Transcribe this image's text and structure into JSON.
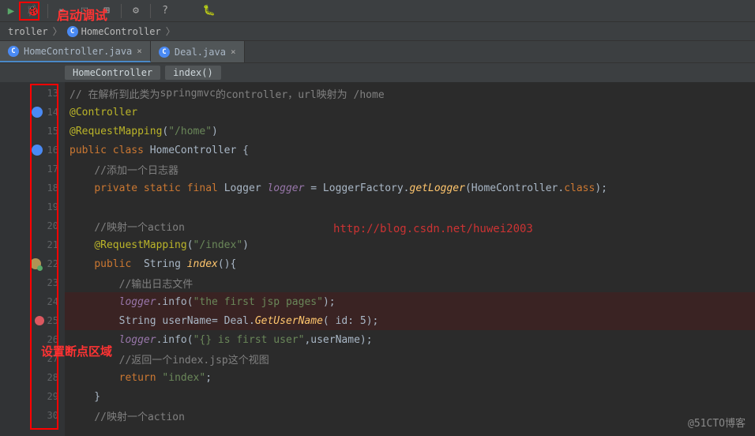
{
  "annotations": {
    "start_debug": "启动调试",
    "breakpoint_region": "设置断点区域"
  },
  "toolbar": {
    "run": "▶",
    "debug": "🐞"
  },
  "breadcrumb": {
    "item1": "troller",
    "item2": "HomeController"
  },
  "tabs": [
    {
      "label": "HomeController.java",
      "active": true
    },
    {
      "label": "Deal.java",
      "active": false
    }
  ],
  "code_breadcrumb": {
    "class": "HomeController",
    "method": "index()"
  },
  "watermark_url": "http://blog.csdn.net/huwei2003",
  "watermark_blog": "@51CTO博客",
  "lines": [
    {
      "n": 13,
      "tokens": [
        [
          "c-comment",
          "// 在解析到此类为"
        ],
        [
          "c-comment",
          "springmvc"
        ],
        [
          "c-comment",
          "的controller，url映射为 /home"
        ]
      ]
    },
    {
      "n": 14,
      "icon": "class",
      "tokens": [
        [
          "c-anno",
          "@Controller"
        ]
      ]
    },
    {
      "n": 15,
      "tokens": [
        [
          "c-anno",
          "@RequestMapping"
        ],
        [
          "c-white",
          "("
        ],
        [
          "c-string",
          "\"/home\""
        ],
        [
          "c-white",
          ")"
        ]
      ]
    },
    {
      "n": 16,
      "icon": "class",
      "tokens": [
        [
          "c-keyword",
          "public class "
        ],
        [
          "c-class",
          "HomeController {"
        ]
      ]
    },
    {
      "n": 17,
      "tokens": [
        [
          "c-white",
          "    "
        ],
        [
          "c-comment",
          "//添加一个日志器"
        ]
      ]
    },
    {
      "n": 18,
      "tokens": [
        [
          "c-white",
          "    "
        ],
        [
          "c-keyword",
          "private static final "
        ],
        [
          "c-class",
          "Logger "
        ],
        [
          "c-field",
          "logger"
        ],
        [
          "c-white",
          " = LoggerFactory."
        ],
        [
          "c-method",
          "getLogger"
        ],
        [
          "c-white",
          "(HomeController."
        ],
        [
          "c-keyword",
          "class"
        ],
        [
          "c-white",
          ");"
        ]
      ]
    },
    {
      "n": 19,
      "tokens": []
    },
    {
      "n": 20,
      "tokens": [
        [
          "c-white",
          "    "
        ],
        [
          "c-comment",
          "//映射一个action"
        ]
      ]
    },
    {
      "n": 21,
      "tokens": [
        [
          "c-white",
          "    "
        ],
        [
          "c-anno",
          "@RequestMapping"
        ],
        [
          "c-white",
          "("
        ],
        [
          "c-string",
          "\"/index\""
        ],
        [
          "c-white",
          ")"
        ]
      ]
    },
    {
      "n": 22,
      "icon": "method",
      "tokens": [
        [
          "c-white",
          "    "
        ],
        [
          "c-keyword",
          "public  "
        ],
        [
          "c-class",
          "String "
        ],
        [
          "c-method",
          "index"
        ],
        [
          "c-white",
          "(){"
        ]
      ]
    },
    {
      "n": 23,
      "tokens": [
        [
          "c-white",
          "        "
        ],
        [
          "c-comment",
          "//输出日志文件"
        ]
      ]
    },
    {
      "n": 24,
      "hl": true,
      "tokens": [
        [
          "c-white",
          "        "
        ],
        [
          "c-field",
          "logger"
        ],
        [
          "c-white",
          ".info("
        ],
        [
          "c-string",
          "\"the first jsp pages\""
        ],
        [
          "c-white",
          ");"
        ]
      ]
    },
    {
      "n": 25,
      "bp": true,
      "hl": true,
      "tokens": [
        [
          "c-white",
          "        String userName= Deal."
        ],
        [
          "c-method",
          "GetUserName"
        ],
        [
          "c-white",
          "( "
        ],
        [
          "c-param",
          "id: "
        ],
        [
          "c-white",
          "5);"
        ]
      ]
    },
    {
      "n": 26,
      "tokens": [
        [
          "c-white",
          "        "
        ],
        [
          "c-field",
          "logger"
        ],
        [
          "c-white",
          ".info("
        ],
        [
          "c-string",
          "\"{} is first user\""
        ],
        [
          "c-white",
          ",userName);"
        ]
      ]
    },
    {
      "n": 27,
      "tokens": [
        [
          "c-white",
          "        "
        ],
        [
          "c-comment",
          "//返回一个index.jsp这个视图"
        ]
      ]
    },
    {
      "n": 28,
      "tokens": [
        [
          "c-white",
          "        "
        ],
        [
          "c-keyword",
          "return "
        ],
        [
          "c-string",
          "\"index\""
        ],
        [
          "c-white",
          ";"
        ]
      ]
    },
    {
      "n": 29,
      "tokens": [
        [
          "c-white",
          "    }"
        ]
      ]
    },
    {
      "n": 30,
      "tokens": [
        [
          "c-white",
          "    "
        ],
        [
          "c-comment",
          "//映射一个action"
        ]
      ]
    }
  ]
}
